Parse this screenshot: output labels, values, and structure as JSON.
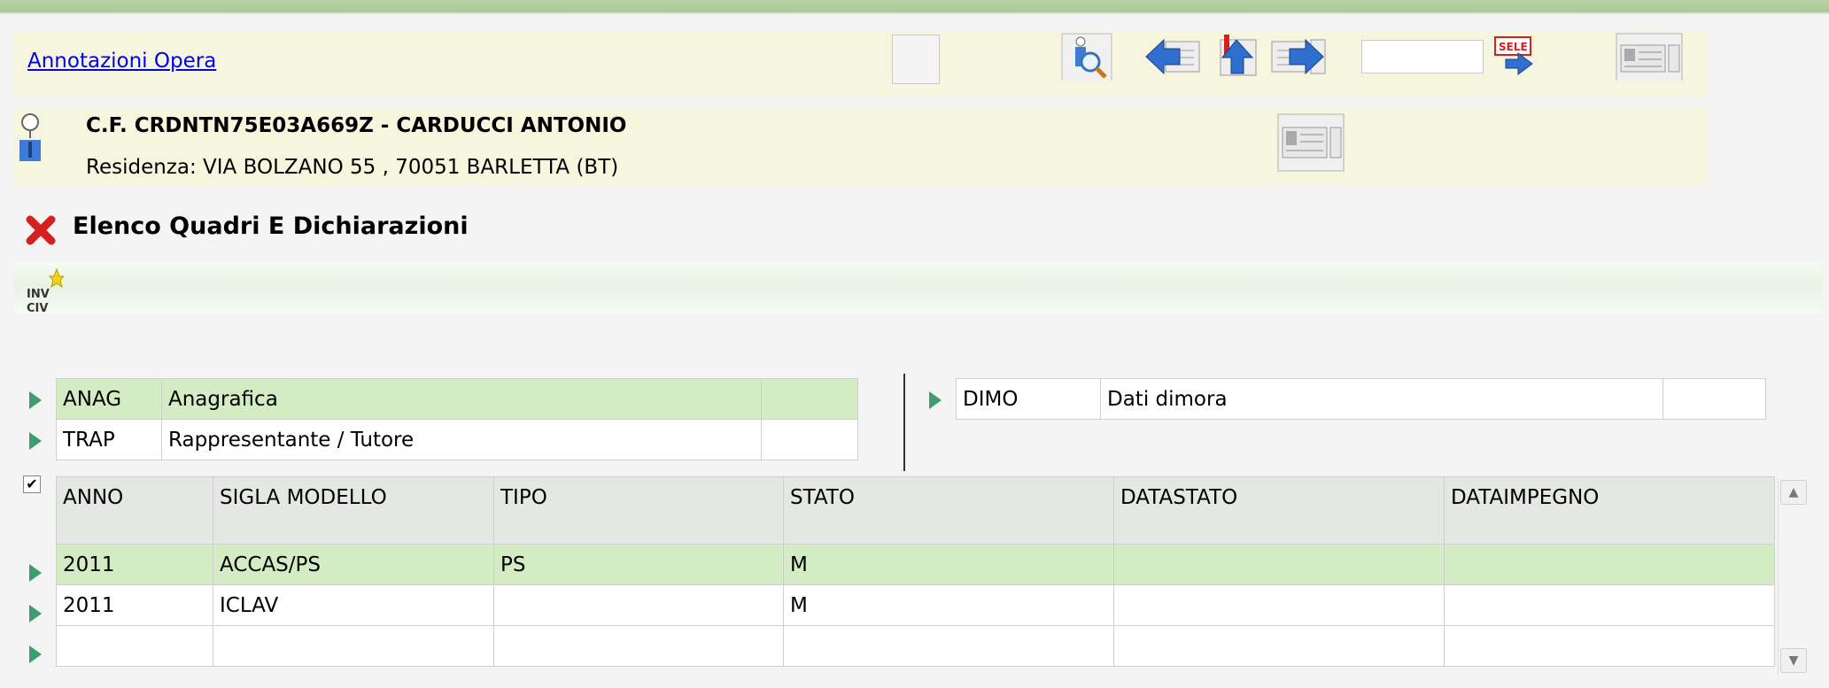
{
  "topbar": {
    "link": "Annotazioni Opera",
    "search_value": ""
  },
  "person": {
    "cf_line": "C.F. CRDNTN75E03A669Z - CARDUCCI ANTONIO",
    "residence": "Residenza: VIA BOLZANO 55 , 70051 BARLETTA (BT)"
  },
  "section": {
    "title": "Elenco Quadri E Dichiarazioni"
  },
  "quadri_left": [
    {
      "code": "ANAG",
      "desc": "Anagrafica",
      "extra": ""
    },
    {
      "code": "TRAP",
      "desc": "Rappresentante / Tutore",
      "extra": ""
    }
  ],
  "quadri_right": [
    {
      "code": "DIMO",
      "desc": "Dati dimora",
      "extra": ""
    }
  ],
  "grid": {
    "headers": [
      "ANNO",
      "SIGLA MODELLO",
      "TIPO",
      "STATO",
      "DATASTATO",
      "DATAIMPEGNO"
    ],
    "rows": [
      [
        "2011",
        "ACCAS/PS",
        "PS",
        "M",
        "",
        ""
      ],
      [
        "2011",
        "ICLAV",
        "",
        "M",
        "",
        ""
      ],
      [
        "",
        "",
        "",
        "",
        "",
        ""
      ]
    ]
  },
  "icons": {
    "close": "red-x-icon",
    "person": "person-icon",
    "inv": "inv-civ-icon",
    "sele_label": "SELE",
    "inv_label_1": "INV",
    "inv_label_2": "CIV",
    "check_mark": "✔"
  },
  "colors": {
    "highlight_row": "#d3ecc4",
    "panel_bg": "#f6f6df",
    "arrow": "#3f9c6e",
    "link": "#0000ee"
  }
}
